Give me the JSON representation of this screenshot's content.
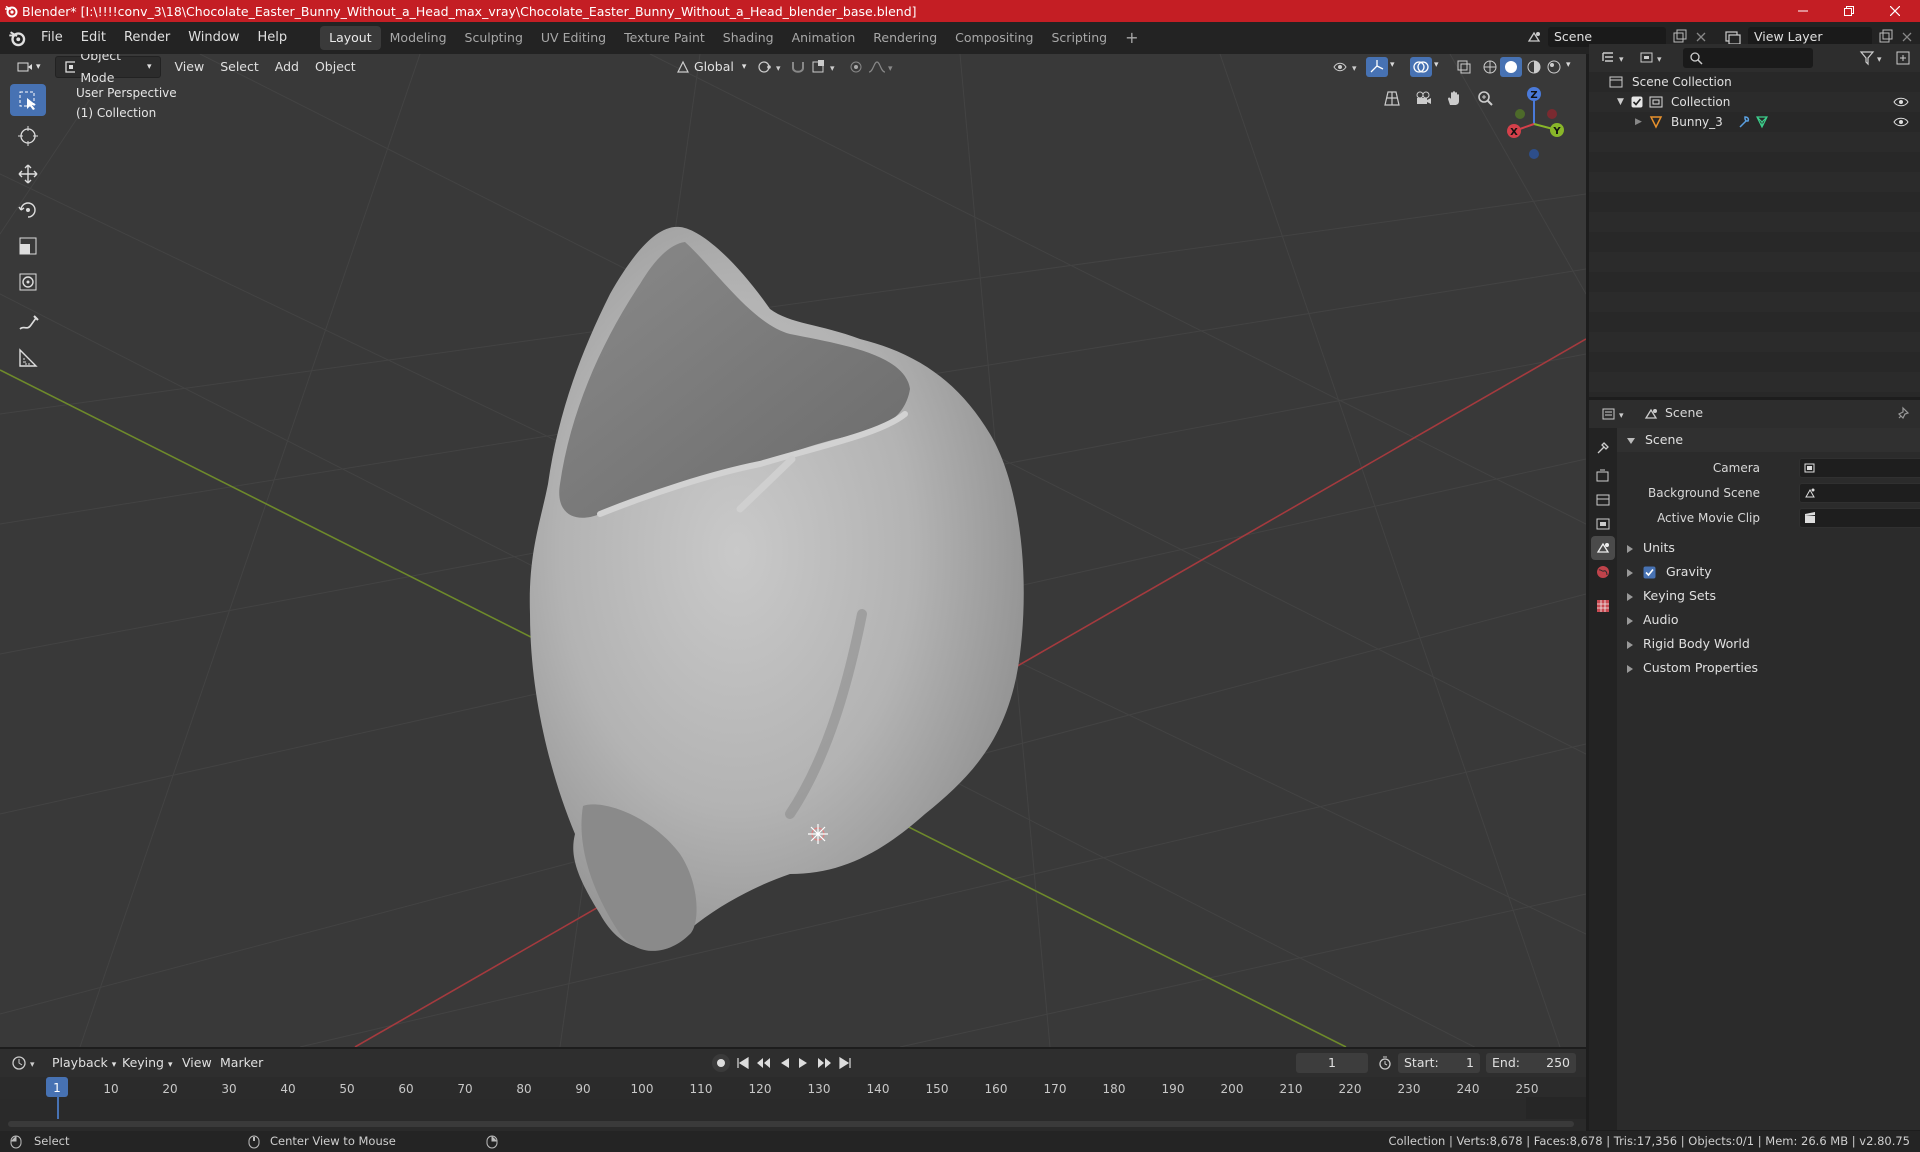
{
  "window": {
    "title": "Blender* [I:\\!!!!conv_3\\18\\Chocolate_Easter_Bunny_Without_a_Head_max_vray\\Chocolate_Easter_Bunny_Without_a_Head_blender_base.blend]",
    "controls": [
      "minimize",
      "maximize",
      "close"
    ]
  },
  "menu": {
    "items": [
      "File",
      "Edit",
      "Render",
      "Window",
      "Help"
    ],
    "workspaces": [
      "Layout",
      "Modeling",
      "Sculpting",
      "UV Editing",
      "Texture Paint",
      "Shading",
      "Animation",
      "Rendering",
      "Compositing",
      "Scripting"
    ],
    "active_workspace": "Layout",
    "add_workspace": "+",
    "scene": "Scene",
    "view_layer": "View Layer"
  },
  "viewport": {
    "mode": "Object Mode",
    "menus": [
      "View",
      "Select",
      "Add",
      "Object"
    ],
    "orientation": "Global",
    "perspective_label": "User Perspective",
    "collection_label": "(1) Collection",
    "gizmo": {
      "z": "Z",
      "y": "Y",
      "x": "X"
    },
    "colors": {
      "background": "#393939",
      "x_axis": "#c8373e",
      "y_axis": "#7fa32c",
      "active": "#4772b3"
    }
  },
  "outliner": {
    "search_placeholder": "",
    "root": "Scene Collection",
    "collection": "Collection",
    "object": "Bunny_3"
  },
  "properties": {
    "context": "Scene",
    "panel_title": "Scene",
    "fields": {
      "camera": "Camera",
      "background_scene": "Background Scene",
      "active_movie_clip": "Active Movie Clip"
    },
    "sections": [
      "Units",
      "Gravity",
      "Keying Sets",
      "Audio",
      "Rigid Body World",
      "Custom Properties"
    ],
    "gravity_checked": true
  },
  "timeline": {
    "menus": [
      "Playback",
      "Keying",
      "View",
      "Marker"
    ],
    "current_frame": "1",
    "start_label": "Start:",
    "start": "1",
    "end_label": "End:",
    "end": "250",
    "ticks": [
      "1",
      "10",
      "20",
      "30",
      "40",
      "50",
      "60",
      "70",
      "80",
      "90",
      "100",
      "110",
      "120",
      "130",
      "140",
      "150",
      "160",
      "170",
      "180",
      "190",
      "200",
      "210",
      "220",
      "230",
      "240",
      "250"
    ]
  },
  "status": {
    "left_action": "Select",
    "middle_action": "Center View to Mouse",
    "stats": "Collection | Verts:8,678 | Faces:8,678 | Tris:17,356 | Objects:0/1 | Mem: 26.6 MB | v2.80.75"
  }
}
